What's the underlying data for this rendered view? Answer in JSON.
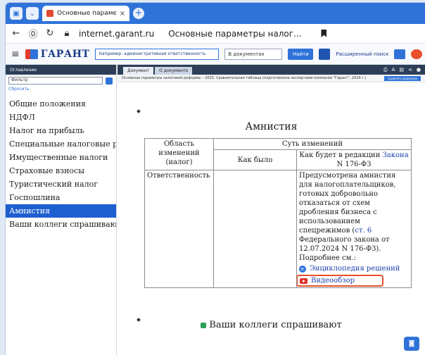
{
  "browser": {
    "tab_title": "Основные параметры",
    "tab_close": "×",
    "new_tab": "+",
    "url": "internet.garant.ru",
    "page_title": "Основные параметры налог..."
  },
  "toolbar": {
    "logo_text": "ГАРАНТ",
    "search_placeholder": "Например: административная ответственность",
    "doc_select": "В документах",
    "find_label": "Найти",
    "adv_search": "Расширенный поиск"
  },
  "sidebar": {
    "header": "Оглавление",
    "search_value": "Фильтр",
    "reset": "Сбросить",
    "items": [
      {
        "label": "Общие положения"
      },
      {
        "label": "НДФЛ"
      },
      {
        "label": "Налог на прибыль"
      },
      {
        "label": "Специальные налоговые р"
      },
      {
        "label": "Имущественные налоги"
      },
      {
        "label": "Страховые взносы"
      },
      {
        "label": "Туристический налог"
      },
      {
        "label": "Госпошлина"
      },
      {
        "label": "Амнистия",
        "active": true
      },
      {
        "label": "Ваши коллеги спрашиваю"
      }
    ]
  },
  "document": {
    "tab_doc": "Документ",
    "tab_info": "О документе",
    "breadcrumb": "Основные параметры налоговой реформы – 2025. Сравнительная таблица (подготовлена экспертами компании \"Гарант\", 2024 г.)",
    "compare_btn": "Сравнить редакции",
    "heading": "Амнистия",
    "table": {
      "col_area": "Область изменений (налог)",
      "col_changes": "Суть изменений",
      "col_before": "Как было",
      "col_after_prefix": "Как будет в редакции ",
      "col_after_link": "Закона",
      "col_after_suffix": "N 176-ФЗ",
      "row_area": "Ответственность",
      "row_before": "",
      "row_after_text": "Предусмотрена амнистия для налогоплательщиков, готовых добровольно отказаться от схем дробления бизнеса с использованием спецрежимов",
      "row_after_ref_open": "(",
      "row_after_ref_link": "ст. 6",
      "row_after_ref_rest": " Федерального закона от 12.07.2024 N 176-ФЗ).",
      "more": "Подробнее см.:",
      "link_encyclopedia": "Энциклопедия решений",
      "link_video": "Видеообзор"
    },
    "colleagues_heading": "Ваши коллеги спрашивают"
  }
}
